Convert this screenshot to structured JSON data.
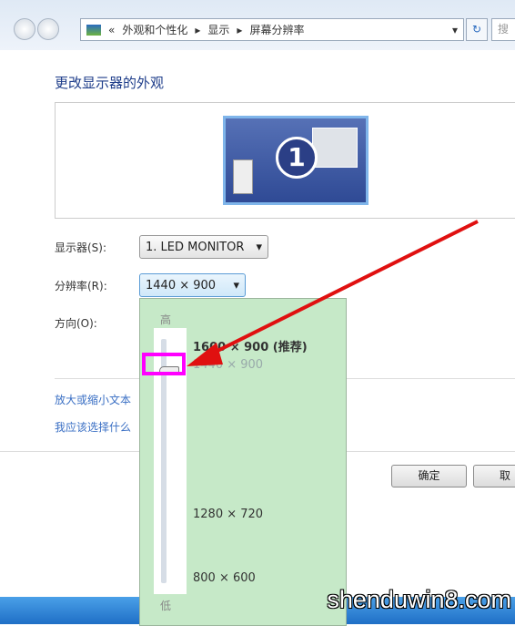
{
  "breadcrumb": {
    "prefix": "«",
    "items": [
      "外观和个性化",
      "显示",
      "屏幕分辨率"
    ],
    "search_placeholder": "搜"
  },
  "page_title": "更改显示器的外观",
  "monitor_number": "1",
  "display": {
    "label": "显示器(S):",
    "value": "1. LED MONITOR"
  },
  "resolution": {
    "label": "分辨率(R):",
    "value": "1440 × 900"
  },
  "orientation": {
    "label": "方向(O):"
  },
  "links": [
    "放大或缩小文本",
    "我应该选择什么"
  ],
  "buttons": {
    "ok": "确定",
    "cancel": "取"
  },
  "resolution_popup": {
    "high": "高",
    "low": "低",
    "options": [
      "1600 × 900 (推荐)",
      "1440 × 900",
      "1280 × 720",
      "800 × 600"
    ],
    "selected": "1440 × 900"
  },
  "watermark": "shenduwin8.com",
  "colors": {
    "popup_bg": "#c6e9c8",
    "highlight": "#ff00ff",
    "arrow": "#e01010"
  }
}
